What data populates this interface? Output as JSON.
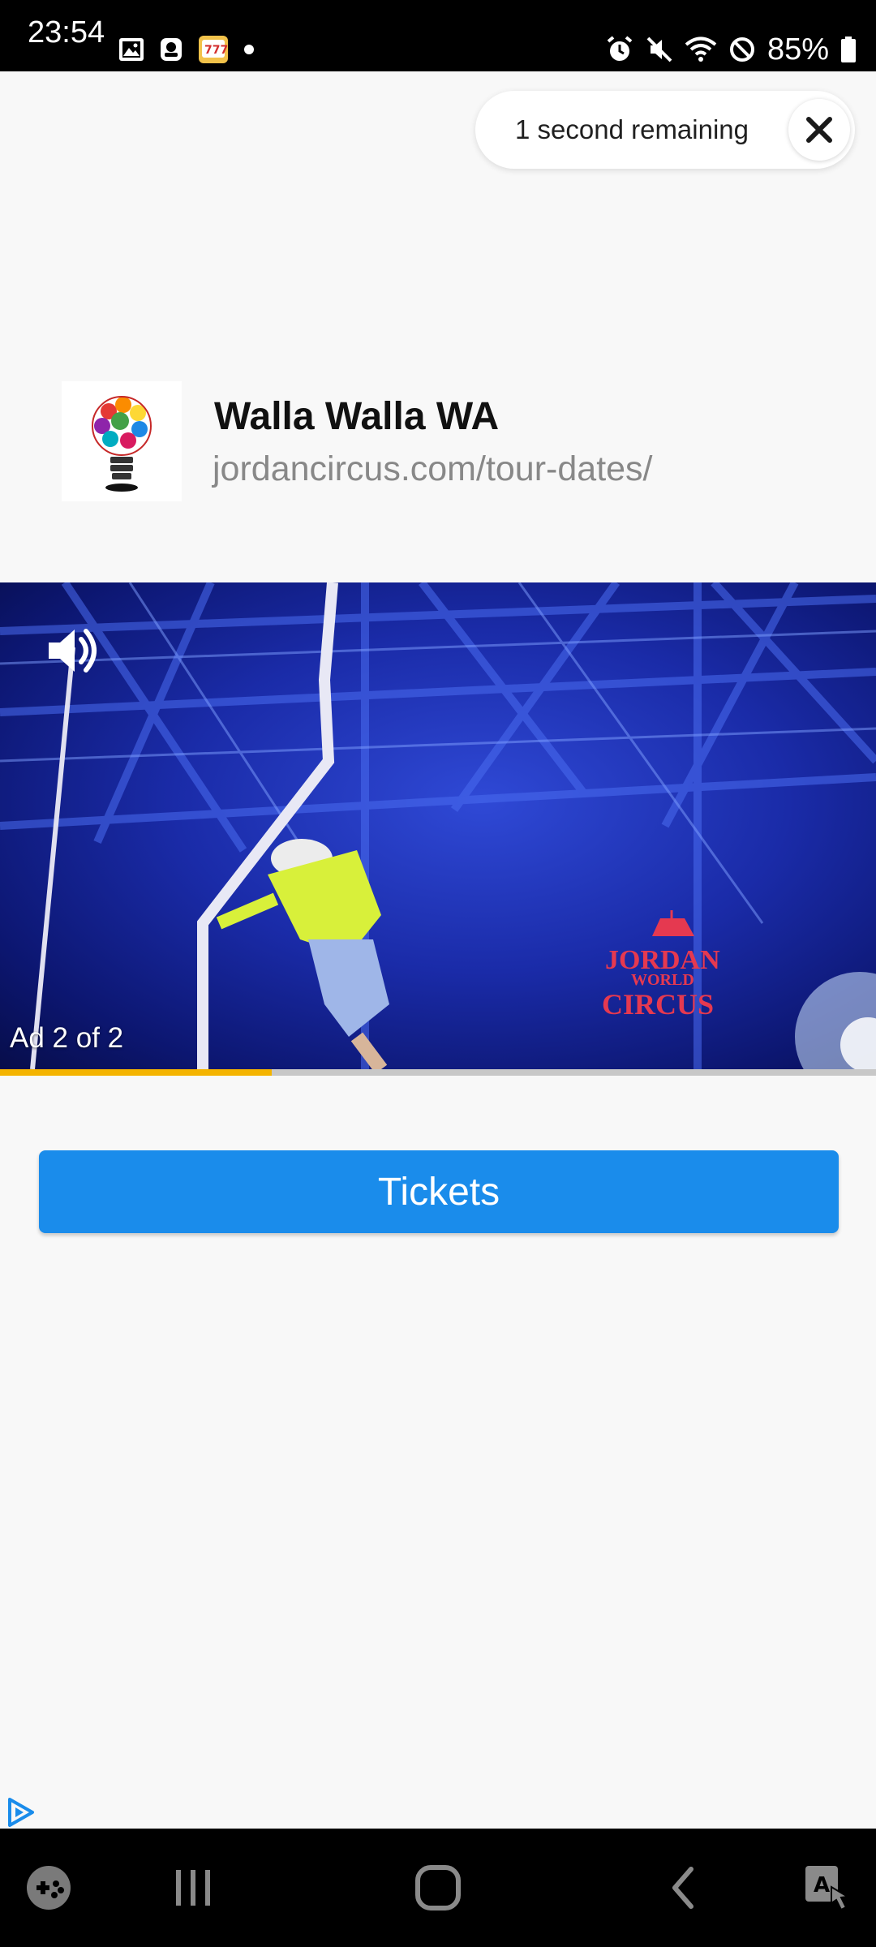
{
  "status_bar": {
    "time": "23:54",
    "battery_percent": "85%",
    "left_icons": [
      "gallery-icon",
      "app-badge-icon",
      "slot-game-icon",
      "notification-dot"
    ],
    "right_icons": [
      "alarm-icon",
      "mute-icon",
      "wifi-icon",
      "do-not-disturb-icon",
      "battery-icon"
    ]
  },
  "ad": {
    "countdown_text": "1 second remaining",
    "close_icon": "close-icon",
    "advertiser_title": "Walla Walla WA",
    "advertiser_url": "jordancircus.com/tour-dates/",
    "advertiser_logo_icon": "lightbulb-logo-icon",
    "video": {
      "mute_icon": "speaker-icon",
      "ad_counter": "Ad 2 of 2",
      "brand_logo_text": [
        "JORDAN",
        "WORLD",
        "CIRCUS"
      ],
      "progress": 0.31
    },
    "cta_label": "Tickets",
    "adchoices_icon": "adchoices-icon"
  },
  "colors": {
    "cta": "#1a8ceb",
    "progress": "#f4b400",
    "page_bg": "#f8f8f8"
  },
  "nav_bar": {
    "items": [
      "game-launcher-icon",
      "recent-apps-icon",
      "home-icon",
      "back-icon",
      "accessibility-icon"
    ]
  }
}
